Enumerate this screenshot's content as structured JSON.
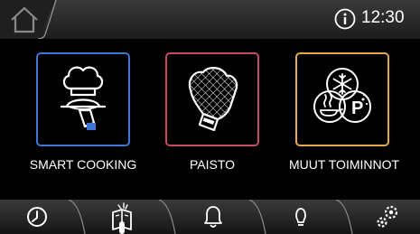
{
  "status_bar": {
    "time": "12:30",
    "home_icon": "home-icon",
    "info_icon": "info-icon"
  },
  "tiles": [
    {
      "label": "SMART COOKING",
      "icon": "chef-serving-icon",
      "color": "#3f74d6"
    },
    {
      "label": "PAISTO",
      "icon": "oven-mitt-icon",
      "color": "#c94a62"
    },
    {
      "label": "MUUT TOIMINNOT",
      "icon": "other-functions-icon",
      "color": "#e5a84a"
    }
  ],
  "bottom_nav": [
    {
      "icon": "timer-icon"
    },
    {
      "icon": "recipe-book-icon"
    },
    {
      "icon": "bell-icon"
    },
    {
      "icon": "lightbulb-icon"
    },
    {
      "icon": "settings-gears-icon"
    }
  ]
}
